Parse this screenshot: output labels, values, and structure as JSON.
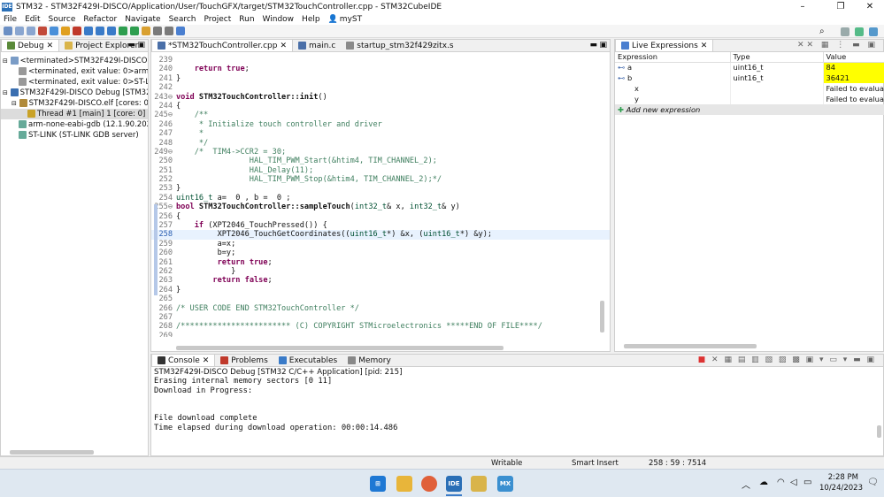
{
  "window": {
    "title": "STM32 - STM32F429I-DISCO/Application/User/TouchGFX/target/STM32TouchController.cpp - STM32CubeIDE",
    "logo": "IDE",
    "controls": [
      "–",
      "❐",
      "✕"
    ]
  },
  "menu": {
    "items": [
      "File",
      "Edit",
      "Source",
      "Refactor",
      "Navigate",
      "Search",
      "Project",
      "Run",
      "Window",
      "Help"
    ],
    "user": "myST"
  },
  "left_panel": {
    "tabs": [
      {
        "label": "Debug"
      },
      {
        "label": "Project Explorer"
      }
    ],
    "tree": [
      {
        "label": "<terminated>STM32F429I-DISCO Debug [",
        "indent": 0
      },
      {
        "label": "<terminated, exit value: 0>arm-none-e",
        "indent": 1
      },
      {
        "label": "<terminated, exit value: 0>ST-LINK (ST-",
        "indent": 1
      },
      {
        "label": "STM32F429I-DISCO Debug [STM32 C/C++",
        "indent": 0
      },
      {
        "label": "STM32F429I-DISCO.elf [cores: 0]",
        "indent": 1
      },
      {
        "label": "Thread #1 [main] 1 [core: 0] (Runnin",
        "indent": 2
      },
      {
        "label": "arm-none-eabi-gdb (12.1.90.20220802)",
        "indent": 1
      },
      {
        "label": "ST-LINK (ST-LINK GDB server)",
        "indent": 1
      }
    ]
  },
  "editor": {
    "tabs": [
      {
        "label": "*STM32TouchController.cpp"
      },
      {
        "label": "main.c"
      },
      {
        "label": "startup_stm32f429zitx.s"
      }
    ],
    "lines": [
      {
        "n": "239",
        "t": ""
      },
      {
        "n": "240",
        "t": "    return true;"
      },
      {
        "n": "241",
        "t": "}"
      },
      {
        "n": "242",
        "t": ""
      },
      {
        "n": "243⊖",
        "t": "void STM32TouchController::init()"
      },
      {
        "n": "244",
        "t": "{"
      },
      {
        "n": "245⊖",
        "t": "    /**"
      },
      {
        "n": "246",
        "t": "     * Initialize touch controller and driver"
      },
      {
        "n": "247",
        "t": "     *"
      },
      {
        "n": "248",
        "t": "     */"
      },
      {
        "n": "249⊖",
        "t": "    /*  TIM4->CCR2 = 30;"
      },
      {
        "n": "250",
        "t": "                HAL_TIM_PWM_Start(&htim4, TIM_CHANNEL_2);"
      },
      {
        "n": "251",
        "t": "                HAL_Delay(11);"
      },
      {
        "n": "252",
        "t": "                HAL_TIM_PWM_Stop(&htim4, TIM_CHANNEL_2);*/"
      },
      {
        "n": "253",
        "t": "}"
      },
      {
        "n": "254",
        "t": "uint16_t a=  0 , b =  0 ;"
      },
      {
        "n": "255⊖",
        "t": "bool STM32TouchController::sampleTouch(int32_t& x, int32_t& y)"
      },
      {
        "n": "256",
        "t": "{"
      },
      {
        "n": "257",
        "t": "    if (XPT2046_TouchPressed()) {"
      },
      {
        "n": "258",
        "t": "         XPT2046_TouchGetCoordinates((uint16_t*) &x, (uint16_t*) &y);"
      },
      {
        "n": "259",
        "t": "         a=x;"
      },
      {
        "n": "260",
        "t": "         b=y;"
      },
      {
        "n": "261",
        "t": "         return true;"
      },
      {
        "n": "262",
        "t": "            }"
      },
      {
        "n": "263",
        "t": "        return false;"
      },
      {
        "n": "264",
        "t": "}"
      },
      {
        "n": "265",
        "t": ""
      },
      {
        "n": "266",
        "t": "/* USER CODE END STM32TouchController */"
      },
      {
        "n": "267",
        "t": ""
      },
      {
        "n": "268",
        "t": "/************************ (C) COPYRIGHT STMicroelectronics *****END OF FILE****/"
      },
      {
        "n": "269",
        "t": ""
      }
    ]
  },
  "live_expressions": {
    "tab": "Live Expressions",
    "columns": [
      "Expression",
      "Type",
      "Value"
    ],
    "rows": [
      {
        "expr": "a",
        "type": "uint16_t",
        "value": "84",
        "highlight": true
      },
      {
        "expr": "b",
        "type": "uint16_t",
        "value": "36421",
        "highlight": true
      },
      {
        "expr": "x",
        "type": "",
        "value": "Failed to evaluate e",
        "highlight": false
      },
      {
        "expr": "y",
        "type": "",
        "value": "Failed to evaluate e",
        "highlight": false
      }
    ],
    "add_label": "Add new expression",
    "highlight_color": "#ffff00"
  },
  "console": {
    "tabs": [
      {
        "label": "Console"
      },
      {
        "label": "Problems"
      },
      {
        "label": "Executables"
      },
      {
        "label": "Memory"
      }
    ],
    "header": "STM32F429I-DISCO Debug [STM32 C/C++ Application] [pid: 215]",
    "lines": [
      "Erasing internal memory sectors [0 11]",
      "Download in Progress:",
      "",
      "",
      "File download complete",
      "Time elapsed during download operation: 00:00:14.486"
    ]
  },
  "status": {
    "mode": "Writable",
    "insert": "Smart Insert",
    "position": "258 : 59 : 7514"
  },
  "taskbar": {
    "time": "2:28 PM",
    "date": "10/24/2023"
  }
}
